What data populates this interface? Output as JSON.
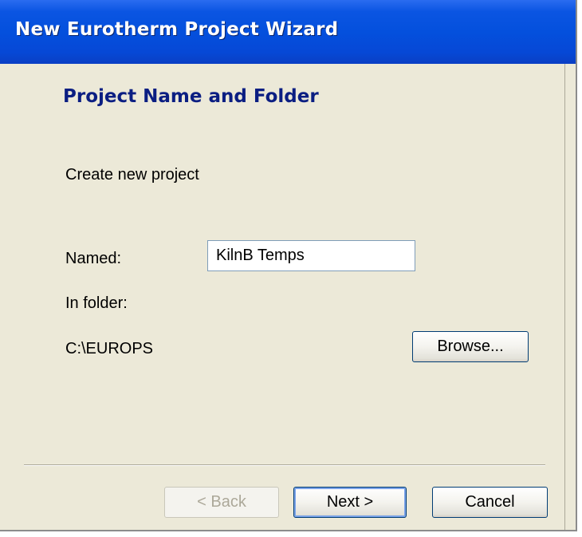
{
  "window": {
    "title": "New Eurotherm Project Wizard"
  },
  "page": {
    "heading": "Project Name and Folder",
    "intro": "Create new project"
  },
  "form": {
    "named_label": "Named:",
    "named_value": "KilnB Temps",
    "folder_label": "In folder:",
    "folder_path": "C:\\EUROPS",
    "browse_label": "Browse..."
  },
  "buttons": {
    "back_label": "< Back",
    "next_label": "Next >",
    "cancel_label": "Cancel"
  },
  "colors": {
    "titlebar": "#0450dd",
    "heading": "#0b1e82",
    "dialog_bg": "#ece9d8"
  }
}
